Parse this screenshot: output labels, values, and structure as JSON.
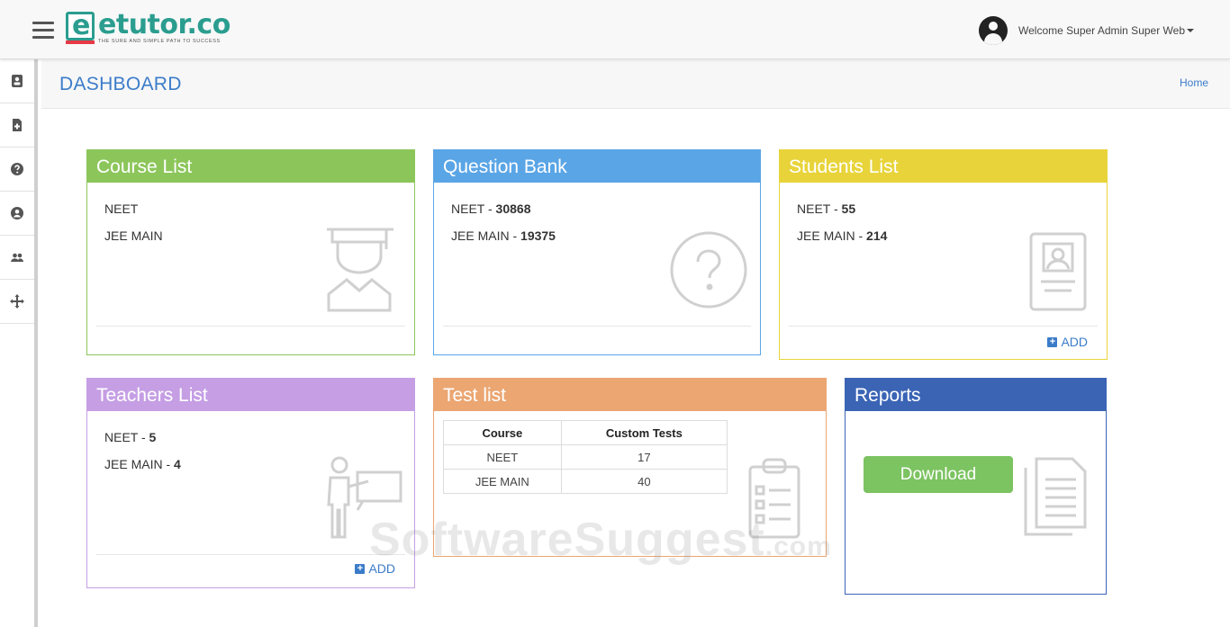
{
  "header": {
    "logo_text": "etutor.co",
    "logo_tagline": "THE SURE AND SIMPLE PATH TO SUCCESS",
    "welcome": "Welcome Super Admin Super Web"
  },
  "sidebar": {
    "items": [
      {
        "icon": "id-card-icon"
      },
      {
        "icon": "file-add-icon"
      },
      {
        "icon": "question-circle-icon"
      },
      {
        "icon": "user-circle-icon"
      },
      {
        "icon": "users-icon"
      },
      {
        "icon": "move-arrows-icon"
      }
    ]
  },
  "page": {
    "title": "DASHBOARD",
    "breadcrumb_home": "Home"
  },
  "course_list": {
    "title": "Course List",
    "items": [
      "NEET",
      "JEE MAIN"
    ]
  },
  "question_bank": {
    "title": "Question Bank",
    "items": [
      {
        "label": "NEET",
        "sep": " - ",
        "count": "30868"
      },
      {
        "label": "JEE MAIN",
        "sep": " - ",
        "count": "19375"
      }
    ]
  },
  "students_list": {
    "title": "Students List",
    "items": [
      {
        "label": "NEET",
        "sep": " - ",
        "count": "55"
      },
      {
        "label": "JEE MAIN",
        "sep": " - ",
        "count": "214"
      }
    ],
    "add_label": "ADD"
  },
  "teachers_list": {
    "title": "Teachers List",
    "items": [
      {
        "label": "NEET",
        "sep": " - ",
        "count": "5"
      },
      {
        "label": "JEE MAIN",
        "sep": " - ",
        "count": "4"
      }
    ],
    "add_label": "ADD"
  },
  "test_list": {
    "title": "Test list",
    "columns": [
      "Course",
      "Custom Tests"
    ],
    "rows": [
      [
        "NEET",
        "17"
      ],
      [
        "JEE MAIN",
        "40"
      ]
    ]
  },
  "reports": {
    "title": "Reports",
    "download_label": "Download"
  },
  "watermark": {
    "text": "SoftwareSuggest",
    "suffix": ".com"
  },
  "colors": {
    "course": "#8cc65b",
    "question_bank": "#5aa5e6",
    "students": "#e8d43a",
    "teachers": "#c59ee4",
    "tests": "#eba672",
    "reports": "#3b64b5",
    "link": "#3b7cc9"
  }
}
